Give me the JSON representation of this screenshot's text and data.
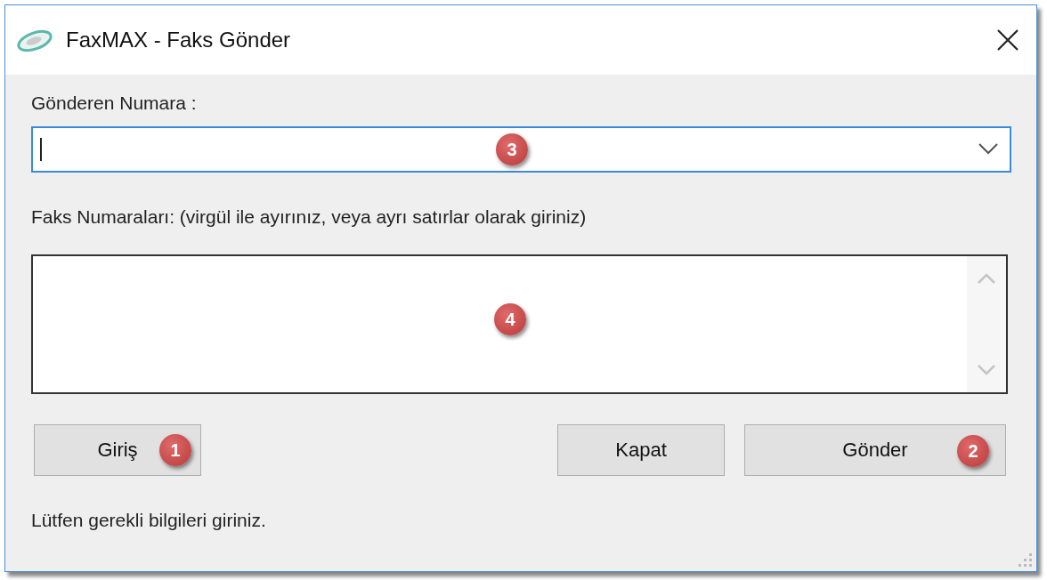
{
  "window": {
    "title": "FaxMAX - Faks Gönder"
  },
  "sender": {
    "label": "Gönderen Numara :",
    "badge": "3"
  },
  "fax_numbers": {
    "label": "Faks Numaraları: (virgül ile ayırınız, veya ayrı satırlar olarak giriniz)",
    "badge": "4"
  },
  "left_buttons": [
    {
      "label": "Giriş",
      "badge": "1"
    }
  ],
  "right_buttons": [
    {
      "label": "Kapat"
    },
    {
      "label": "Gönder",
      "badge": "2"
    }
  ],
  "status_bar": "Lütfen gerekli bilgileri giriniz."
}
